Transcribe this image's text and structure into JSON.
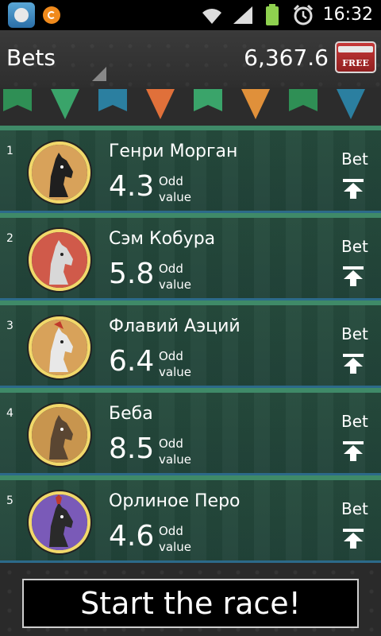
{
  "status_bar": {
    "time": "16:32",
    "icons": [
      "app-icon",
      "notification-icon",
      "wifi-icon",
      "signal-icon",
      "battery-icon",
      "alarm-icon"
    ]
  },
  "header": {
    "title": "Bets",
    "balance": "6,367.6",
    "free_label": "FREE"
  },
  "pennant_colors": [
    "#2f8f55",
    "#3aa46a",
    "#2b7fa0",
    "#e0703a",
    "#3aa46a",
    "#e0903a",
    "#2f8f55",
    "#2b7fa0"
  ],
  "horses": [
    {
      "rank": "1",
      "name": "Генри Морган",
      "odd": "4.3",
      "odd_label_1": "Odd",
      "odd_label_2": "value",
      "bet_label": "Bet",
      "avatar_bg": "#d8a25a",
      "horse_color": "#1f1f1f"
    },
    {
      "rank": "2",
      "name": "Сэм Кобура",
      "odd": "5.8",
      "odd_label_1": "Odd",
      "odd_label_2": "value",
      "bet_label": "Bet",
      "avatar_bg": "#d05a4a",
      "horse_color": "#d8d8d8"
    },
    {
      "rank": "3",
      "name": "Флавий Аэций",
      "odd": "6.4",
      "odd_label_1": "Odd",
      "odd_label_2": "value",
      "bet_label": "Bet",
      "avatar_bg": "#d8a25a",
      "horse_color": "#e8e8e8"
    },
    {
      "rank": "4",
      "name": "Беба",
      "odd": "8.5",
      "odd_label_1": "Odd",
      "odd_label_2": "value",
      "bet_label": "Bet",
      "avatar_bg": "#c8954e",
      "horse_color": "#5a4632"
    },
    {
      "rank": "5",
      "name": "Орлиное Перо",
      "odd": "4.6",
      "odd_label_1": "Odd",
      "odd_label_2": "value",
      "bet_label": "Bet",
      "avatar_bg": "#7a5ab8",
      "horse_color": "#2a2a2a"
    }
  ],
  "footer": {
    "start_label": "Start the race!"
  }
}
